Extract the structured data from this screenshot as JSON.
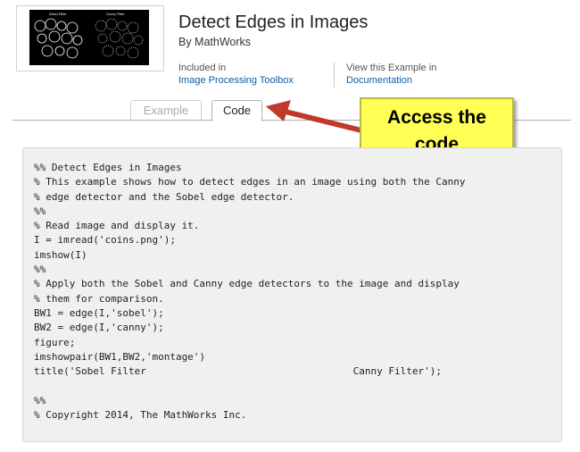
{
  "example": {
    "title": "Detect Edges in Images",
    "author": "By MathWorks",
    "included_in_label": "Included in",
    "included_in_link": "Image Processing Toolbox",
    "view_in_label": "View this Example in",
    "view_in_link": "Documentation"
  },
  "thumbnail": {
    "caption_left": "Sobel Filter",
    "caption_right": "Canny Filter"
  },
  "tabs": [
    {
      "label": "Example",
      "active": false
    },
    {
      "label": "Code",
      "active": true
    }
  ],
  "callout": {
    "line1": "Access the",
    "line2": "code",
    "color": "#ffff55",
    "arrow_color": "#c0392b"
  },
  "code_lines": [
    "%% Detect Edges in Images",
    "% This example shows how to detect edges in an image using both the Canny",
    "% edge detector and the Sobel edge detector.",
    "%%",
    "% Read image and display it.",
    "I = imread('coins.png');",
    "imshow(I)",
    "%%",
    "% Apply both the Sobel and Canny edge detectors to the image and display",
    "% them for comparison.",
    "BW1 = edge(I,'sobel');",
    "BW2 = edge(I,'canny');",
    "figure;",
    "imshowpair(BW1,BW2,'montage')",
    "title('Sobel Filter                                   Canny Filter');",
    "",
    "%%",
    "% Copyright 2014, The MathWorks Inc."
  ]
}
